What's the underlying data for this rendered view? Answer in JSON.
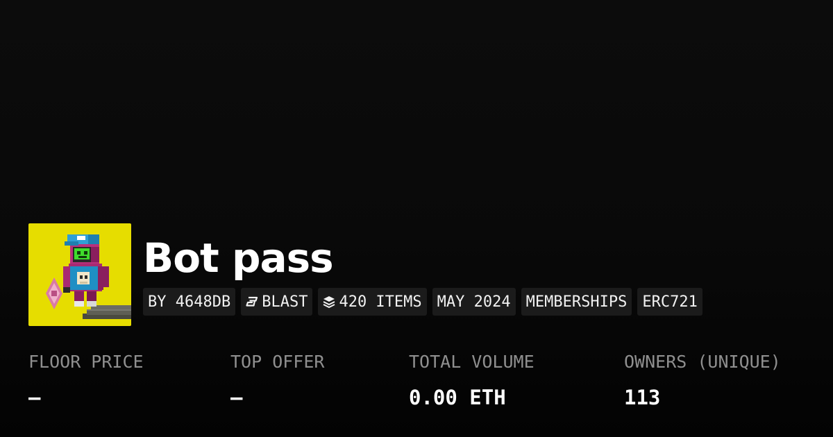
{
  "collection": {
    "name": "Bot pass",
    "image_icon": "pixel-robot-avatar",
    "image_background_color": "#e6dd00"
  },
  "badges": {
    "creator": "BY 4648DB",
    "chain": {
      "label": "BLAST",
      "icon": "blast-logo-icon"
    },
    "items": {
      "label": "420 ITEMS",
      "icon": "layers-icon"
    },
    "date": "MAY 2024",
    "category": "MEMBERSHIPS",
    "standard": "ERC721"
  },
  "stats": [
    {
      "label": "FLOOR PRICE",
      "value": "—"
    },
    {
      "label": "TOP OFFER",
      "value": "—"
    },
    {
      "label": "TOTAL VOLUME",
      "value": "0.00 ETH"
    },
    {
      "label": "OWNERS (UNIQUE)",
      "value": "113"
    }
  ],
  "colors": {
    "background": "#0b0b0b",
    "badge_background": "#1b1b1b",
    "label_gray": "#8f8f8f",
    "text": "#ffffff"
  }
}
